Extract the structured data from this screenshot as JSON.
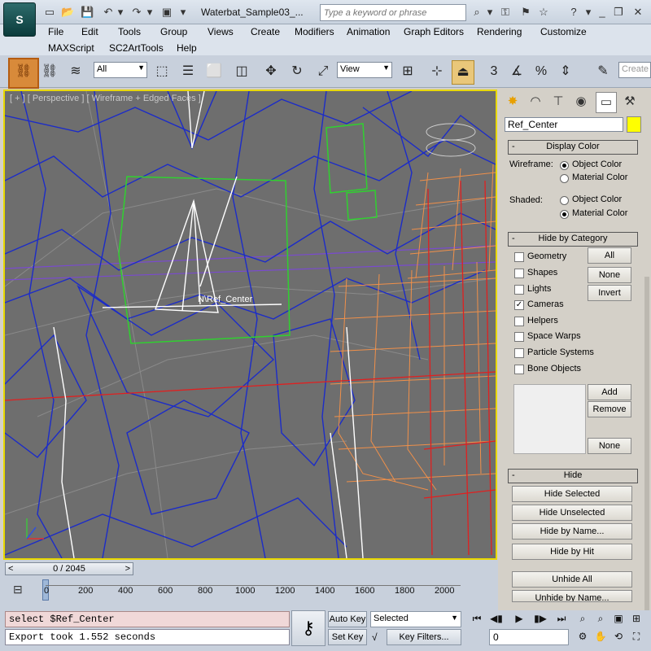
{
  "app": {
    "logo_text": "S",
    "title": "Waterbat_Sample03_..."
  },
  "quick_access": {
    "icons": [
      "new-icon",
      "open-icon",
      "save-icon",
      "undo-icon",
      "redo-icon",
      "project-icon"
    ]
  },
  "search": {
    "placeholder": "Type a keyword or phrase"
  },
  "menu": {
    "row1": [
      "File",
      "Edit",
      "Tools",
      "Group",
      "Views",
      "Create",
      "Modifiers",
      "Animation",
      "Graph Editors",
      "Rendering",
      "Customize"
    ],
    "row2": [
      "MAXScript",
      "SC2ArtTools",
      "Help"
    ]
  },
  "toolbar": {
    "selection_filter": "All",
    "ref_coord": "View",
    "named_selection_placeholder": "Create"
  },
  "viewport": {
    "label": "[ + ] [ Perspective ] [ Wireframe + Edged Faces ]",
    "object_label": "N\\Ref_Center",
    "colors": {
      "frame": "#e8d800",
      "background": "#6e6e6e"
    }
  },
  "command_panel": {
    "object_name": "Ref_Center",
    "object_color": "#ffff00",
    "display_color": {
      "header": "Display Color",
      "wireframe_label": "Wireframe:",
      "shaded_label": "Shaded:",
      "options": [
        "Object Color",
        "Material Color"
      ],
      "wireframe_selected": "Object Color",
      "shaded_selected": "Material Color"
    },
    "hide_by_category": {
      "header": "Hide by Category",
      "categories": [
        {
          "label": "Geometry",
          "checked": false
        },
        {
          "label": "Shapes",
          "checked": false
        },
        {
          "label": "Lights",
          "checked": false
        },
        {
          "label": "Cameras",
          "checked": true
        },
        {
          "label": "Helpers",
          "checked": false
        },
        {
          "label": "Space Warps",
          "checked": false
        },
        {
          "label": "Particle Systems",
          "checked": false
        },
        {
          "label": "Bone Objects",
          "checked": false
        }
      ],
      "all_button": "All",
      "none_button": "None",
      "invert_button": "Invert",
      "add_button": "Add",
      "remove_button": "Remove",
      "none2_button": "None"
    },
    "hide": {
      "header": "Hide",
      "buttons": [
        "Hide Selected",
        "Hide Unselected",
        "Hide by Name...",
        "Hide by Hit",
        "Unhide All",
        "Unhide by Name..."
      ]
    }
  },
  "timeline": {
    "slider_text": "0 / 2045",
    "ticks": [
      "0",
      "200",
      "400",
      "600",
      "800",
      "1000",
      "1200",
      "1400",
      "1600",
      "1800",
      "2000"
    ]
  },
  "status": {
    "maxscript": "select $Ref_Center",
    "message": "Export took 1.552 seconds",
    "auto_key": "Auto Key",
    "set_key": "Set Key",
    "key_mode": "Selected",
    "key_filters": "Key Filters...",
    "frame": "0"
  }
}
